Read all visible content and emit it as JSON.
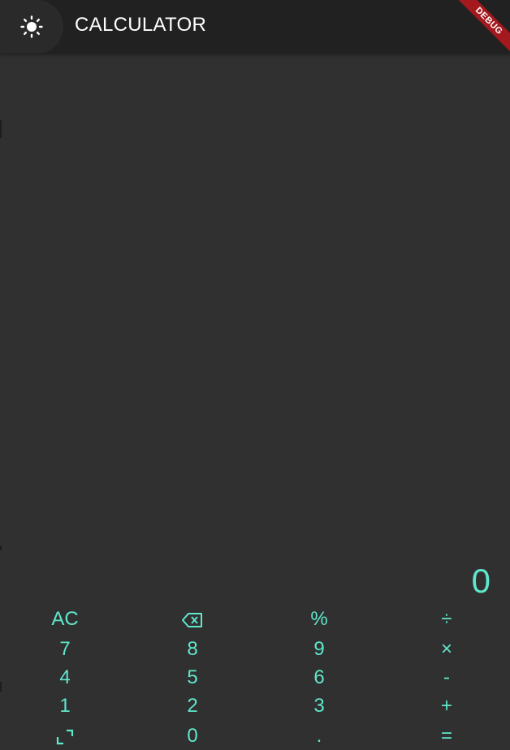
{
  "appbar": {
    "title": "CALCULATOR",
    "theme_icon": "sun-icon",
    "debug_label": "DEBUG"
  },
  "display": {
    "value": "0"
  },
  "colors": {
    "background": "#303030",
    "appbar": "#212121",
    "accent": "#5fe7cc",
    "debug_banner": "#a3191e"
  },
  "keypad": {
    "rows": [
      [
        {
          "label": "AC",
          "name": "all-clear-button"
        },
        {
          "label": "",
          "name": "backspace-button",
          "icon": "backspace-icon"
        },
        {
          "label": "%",
          "name": "percent-button"
        },
        {
          "label": "÷",
          "name": "divide-button"
        }
      ],
      [
        {
          "label": "7",
          "name": "digit-7-button"
        },
        {
          "label": "8",
          "name": "digit-8-button"
        },
        {
          "label": "9",
          "name": "digit-9-button"
        },
        {
          "label": "×",
          "name": "multiply-button"
        }
      ],
      [
        {
          "label": "4",
          "name": "digit-4-button"
        },
        {
          "label": "5",
          "name": "digit-5-button"
        },
        {
          "label": "6",
          "name": "digit-6-button"
        },
        {
          "label": "-",
          "name": "subtract-button"
        }
      ],
      [
        {
          "label": "1",
          "name": "digit-1-button"
        },
        {
          "label": "2",
          "name": "digit-2-button"
        },
        {
          "label": "3",
          "name": "digit-3-button"
        },
        {
          "label": "+",
          "name": "add-button"
        }
      ],
      [
        {
          "label": "",
          "name": "expand-button",
          "icon": "expand-icon"
        },
        {
          "label": "0",
          "name": "digit-0-button"
        },
        {
          "label": ".",
          "name": "decimal-button"
        },
        {
          "label": "=",
          "name": "equals-button"
        }
      ]
    ]
  }
}
